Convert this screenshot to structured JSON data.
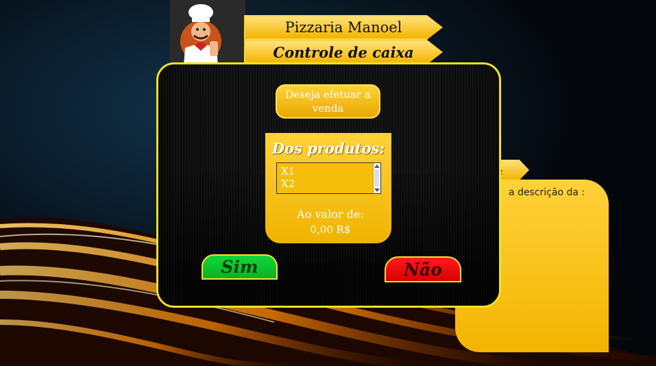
{
  "header": {
    "title": "Pizzaria Manoel",
    "subtitle": "Controle de caixa"
  },
  "background_panel": {
    "tab_label": "ão:",
    "text": "a descrição da :"
  },
  "dialog": {
    "prompt": "Deseja efetuar a venda",
    "products_title": "Dos produtos:",
    "products": [
      "X1",
      "X2"
    ],
    "value_label": "Ao valor de:",
    "value": "0,00 R$",
    "yes_label": "Sim",
    "no_label": "Não"
  },
  "colors": {
    "accent": "#f3b400",
    "dialog_border": "#f3e21e",
    "yes": "#13d63a",
    "no": "#ff1a1a"
  },
  "icons": [
    "chef-logo-icon",
    "scroll-up-icon",
    "scroll-down-icon"
  ]
}
